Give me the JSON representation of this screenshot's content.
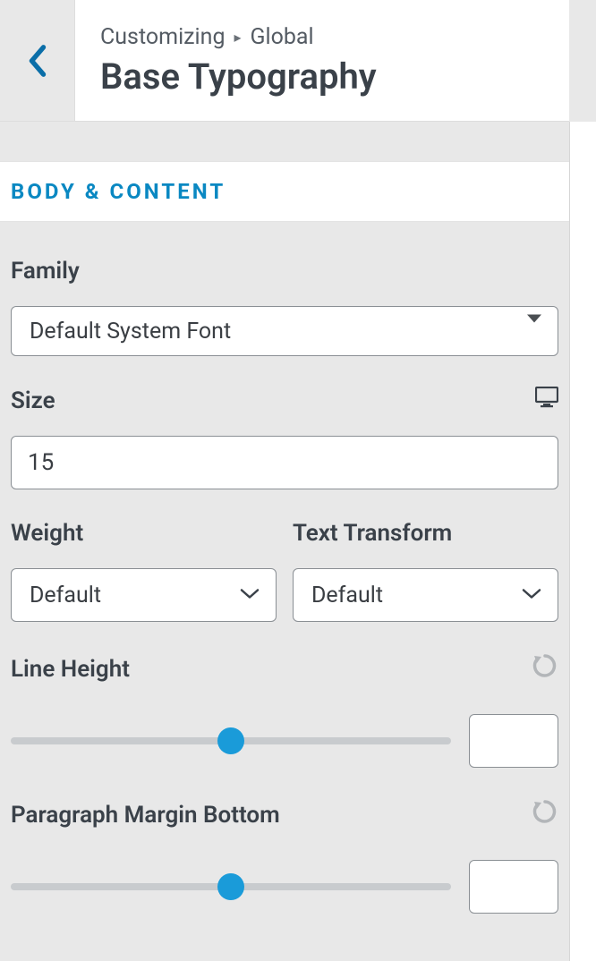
{
  "header": {
    "breadcrumb_root": "Customizing",
    "breadcrumb_section": "Global",
    "title": "Base Typography"
  },
  "section": {
    "heading": "BODY & CONTENT"
  },
  "fields": {
    "family": {
      "label": "Family",
      "value": "Default System Font"
    },
    "size": {
      "label": "Size",
      "value": "15"
    },
    "weight": {
      "label": "Weight",
      "value": "Default"
    },
    "text_transform": {
      "label": "Text Transform",
      "value": "Default"
    },
    "line_height": {
      "label": "Line Height",
      "value": ""
    },
    "paragraph_margin_bottom": {
      "label": "Paragraph Margin Bottom",
      "value": ""
    }
  }
}
